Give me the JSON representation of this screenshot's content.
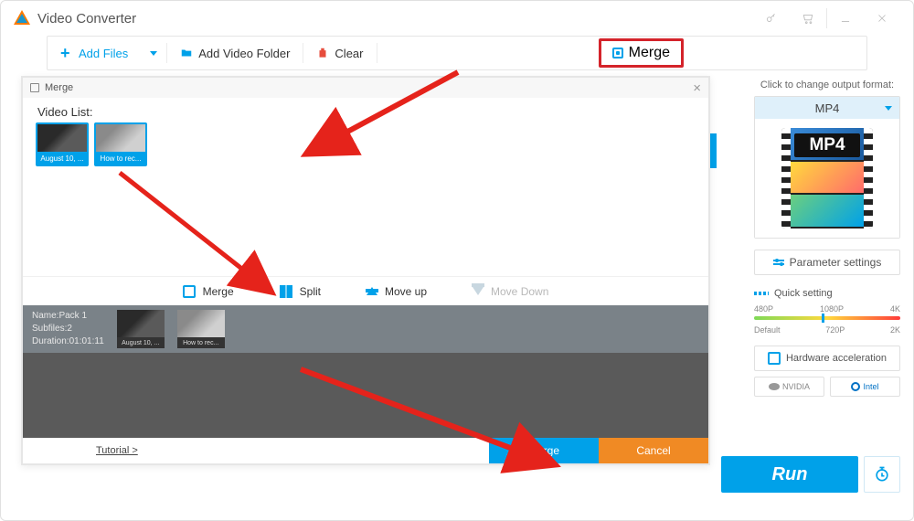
{
  "titlebar": {
    "title": "Video Converter"
  },
  "toolbar": {
    "add_files": "Add Files",
    "add_folder": "Add Video Folder",
    "clear": "Clear",
    "merge": "Merge"
  },
  "right": {
    "change_label": "Click to change output format:",
    "format": "MP4",
    "film_label": "MP4",
    "param_btn": "Parameter settings",
    "quick_label": "Quick setting",
    "res_row1": [
      "480P",
      "1080P",
      "4K"
    ],
    "res_row2": [
      "Default",
      "720P",
      "2K"
    ],
    "hw_label": "Hardware acceleration",
    "gpu": [
      "NVIDIA",
      "Intel"
    ]
  },
  "dialog": {
    "title": "Merge",
    "video_list": "Video List:",
    "thumbs": [
      {
        "caption": "August 10, ..."
      },
      {
        "caption": "How to rec..."
      }
    ],
    "actions": {
      "merge": "Merge",
      "split": "Split",
      "move_up": "Move up",
      "move_down": "Move Down"
    },
    "pack": {
      "name_label": "Name:",
      "name_value": "Pack 1",
      "subfiles_label": "Subfiles:",
      "subfiles_value": "2",
      "duration_label": "Duration:",
      "duration_value": "01:01:11",
      "minis": [
        "August 10, ...",
        "How to rec..."
      ]
    },
    "tutorial": "Tutorial >",
    "footer": {
      "merge": "Merge",
      "cancel": "Cancel"
    }
  },
  "bottom": {
    "run": "Run"
  }
}
